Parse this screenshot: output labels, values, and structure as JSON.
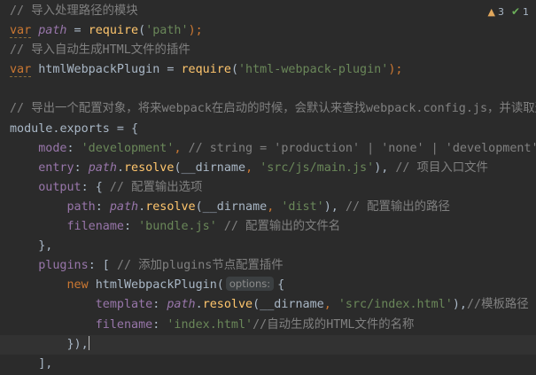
{
  "inspection": {
    "warning_icon": "warning-triangle-icon",
    "warning_count": "3",
    "ok_icon": "check-icon",
    "ok_count": "1"
  },
  "lines": [
    {
      "tokens": [
        {
          "t": "// 导入处理路径的模块",
          "c": "comment"
        }
      ]
    },
    {
      "tokens": [
        {
          "t": "var",
          "c": "kw",
          "u": true
        },
        {
          "t": " ",
          "c": "plain"
        },
        {
          "t": "path",
          "c": "varit"
        },
        {
          "t": " = ",
          "c": "plain"
        },
        {
          "t": "require",
          "c": "fn"
        },
        {
          "t": "(",
          "c": "plain"
        },
        {
          "t": "'path'",
          "c": "str"
        },
        {
          "t": ");",
          "c": "pun"
        }
      ]
    },
    {
      "tokens": [
        {
          "t": "// 导入自动生成HTML文件的插件",
          "c": "comment"
        }
      ]
    },
    {
      "tokens": [
        {
          "t": "var",
          "c": "kw",
          "u": true
        },
        {
          "t": " htmlWebpackPlugin = ",
          "c": "plain"
        },
        {
          "t": "require",
          "c": "fn"
        },
        {
          "t": "(",
          "c": "plain"
        },
        {
          "t": "'html-webpack-plugin'",
          "c": "str"
        },
        {
          "t": ");",
          "c": "pun"
        }
      ]
    },
    {
      "tokens": []
    },
    {
      "tokens": [
        {
          "t": "// 导出一个配置对象，将来webpack在启动的时候，会默认来查找webpack.config.js，并读取这",
          "c": "comment"
        }
      ]
    },
    {
      "tokens": [
        {
          "t": "module",
          "c": "plain"
        },
        {
          "t": ".",
          "c": "plain"
        },
        {
          "t": "exports",
          "c": "plain"
        },
        {
          "t": " = {",
          "c": "plain"
        }
      ]
    },
    {
      "tokens": [
        {
          "t": "    ",
          "c": "plain"
        },
        {
          "t": "mode",
          "c": "prop"
        },
        {
          "t": ": ",
          "c": "plain"
        },
        {
          "t": "'development'",
          "c": "str"
        },
        {
          "t": ", ",
          "c": "pun"
        },
        {
          "t": "// string = 'production' | 'none' | 'development'",
          "c": "comment"
        }
      ]
    },
    {
      "tokens": [
        {
          "t": "    ",
          "c": "plain"
        },
        {
          "t": "entry",
          "c": "prop"
        },
        {
          "t": ": ",
          "c": "plain"
        },
        {
          "t": "path",
          "c": "varit"
        },
        {
          "t": ".",
          "c": "plain"
        },
        {
          "t": "resolve",
          "c": "fn"
        },
        {
          "t": "(__dirname",
          "c": "plain"
        },
        {
          "t": ", ",
          "c": "pun"
        },
        {
          "t": "'src/js/main.js'",
          "c": "str"
        },
        {
          "t": "), ",
          "c": "plain"
        },
        {
          "t": "// 项目入口文件",
          "c": "comment"
        }
      ]
    },
    {
      "tokens": [
        {
          "t": "    ",
          "c": "plain"
        },
        {
          "t": "output",
          "c": "prop"
        },
        {
          "t": ": { ",
          "c": "plain"
        },
        {
          "t": "// 配置输出选项",
          "c": "comment"
        }
      ]
    },
    {
      "tokens": [
        {
          "t": "        ",
          "c": "plain"
        },
        {
          "t": "path",
          "c": "prop"
        },
        {
          "t": ": ",
          "c": "plain"
        },
        {
          "t": "path",
          "c": "varit"
        },
        {
          "t": ".",
          "c": "plain"
        },
        {
          "t": "resolve",
          "c": "fn"
        },
        {
          "t": "(__dirname",
          "c": "plain"
        },
        {
          "t": ", ",
          "c": "pun"
        },
        {
          "t": "'dist'",
          "c": "str"
        },
        {
          "t": "), ",
          "c": "plain"
        },
        {
          "t": "// 配置输出的路径",
          "c": "comment"
        }
      ]
    },
    {
      "tokens": [
        {
          "t": "        ",
          "c": "plain"
        },
        {
          "t": "filename",
          "c": "prop"
        },
        {
          "t": ": ",
          "c": "plain"
        },
        {
          "t": "'bundle.js'",
          "c": "str"
        },
        {
          "t": " ",
          "c": "plain"
        },
        {
          "t": "// 配置输出的文件名",
          "c": "comment"
        }
      ]
    },
    {
      "tokens": [
        {
          "t": "    },",
          "c": "plain"
        }
      ]
    },
    {
      "tokens": [
        {
          "t": "    ",
          "c": "plain"
        },
        {
          "t": "plugins",
          "c": "prop"
        },
        {
          "t": ": [ ",
          "c": "plain"
        },
        {
          "t": "// 添加plugins节点配置插件",
          "c": "comment"
        }
      ]
    },
    {
      "tokens": [
        {
          "t": "        ",
          "c": "plain"
        },
        {
          "t": "new",
          "c": "kw"
        },
        {
          "t": " htmlWebpackPlugin(",
          "c": "plain"
        },
        {
          "t": "options:",
          "c": "hint"
        },
        {
          "t": "{",
          "c": "plain"
        }
      ]
    },
    {
      "tokens": [
        {
          "t": "            ",
          "c": "plain"
        },
        {
          "t": "template",
          "c": "prop"
        },
        {
          "t": ": ",
          "c": "plain"
        },
        {
          "t": "path",
          "c": "varit"
        },
        {
          "t": ".",
          "c": "plain"
        },
        {
          "t": "resolve",
          "c": "fn"
        },
        {
          "t": "(__dirname",
          "c": "plain"
        },
        {
          "t": ", ",
          "c": "pun"
        },
        {
          "t": "'src/index.html'",
          "c": "str"
        },
        {
          "t": "),",
          "c": "plain"
        },
        {
          "t": "//模板路径",
          "c": "comment"
        }
      ]
    },
    {
      "tokens": [
        {
          "t": "            ",
          "c": "plain"
        },
        {
          "t": "filename",
          "c": "prop"
        },
        {
          "t": ": ",
          "c": "plain"
        },
        {
          "t": "'index.html'",
          "c": "str"
        },
        {
          "t": "//自动生成的HTML文件的名称",
          "c": "comment"
        }
      ]
    },
    {
      "current": true,
      "tokens": [
        {
          "t": "        }),",
          "c": "plain"
        },
        {
          "t": "",
          "c": "caret"
        }
      ]
    },
    {
      "tokens": [
        {
          "t": "    ],",
          "c": "plain"
        }
      ]
    }
  ]
}
